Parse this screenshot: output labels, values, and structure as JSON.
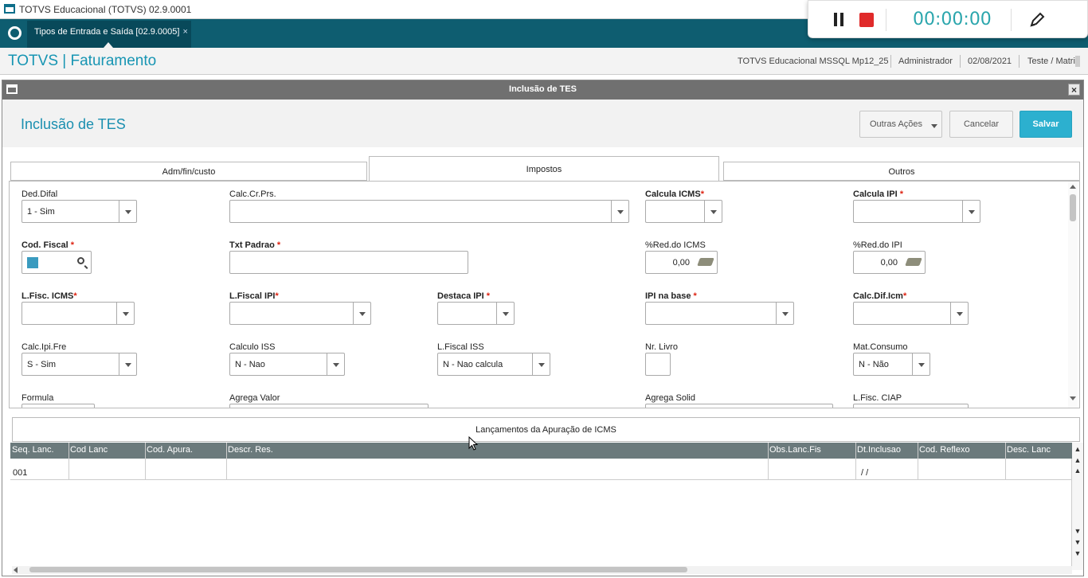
{
  "window": {
    "title": "TOTVS Educacional (TOTVS) 02.9.0001"
  },
  "recorder": {
    "time": "00:00:00"
  },
  "tab": {
    "label": "Tipos de Entrada e Saída [02.9.0005]",
    "close": "×"
  },
  "header": {
    "brand": "TOTVS | Faturamento",
    "company": "TOTVS Educacional MSSQL Mp12_25",
    "user": "Administrador",
    "date": "02/08/2021",
    "branch": "Teste / Matriz"
  },
  "dialog": {
    "bar_title": "Inclusão de TES",
    "close": "×",
    "title": "Inclusão de TES",
    "buttons": {
      "other": "Outras Ações",
      "cancel": "Cancelar",
      "save": "Salvar"
    }
  },
  "tabs": [
    {
      "label": "Adm/fin/custo"
    },
    {
      "label": "Impostos"
    },
    {
      "label": "Outros"
    }
  ],
  "fields": {
    "ded_difal": {
      "label": "Ded.Difal",
      "value": "1 - Sim"
    },
    "calc_cr_prs": {
      "label": "Calc.Cr.Prs.",
      "value": ""
    },
    "calcula_icms": {
      "label": "Calcula ICMS",
      "value": ""
    },
    "calcula_ipi": {
      "label": "Calcula IPI ",
      "value": ""
    },
    "cod_fiscal": {
      "label": "Cod. Fiscal ",
      "value": ""
    },
    "txt_padrao": {
      "label": "Txt Padrao ",
      "value": ""
    },
    "red_icms": {
      "label": "%Red.do ICMS",
      "value": "0,00"
    },
    "red_ipi": {
      "label": "%Red.do IPI",
      "value": "0,00"
    },
    "l_fisc_icms": {
      "label": "L.Fisc. ICMS",
      "value": ""
    },
    "l_fiscal_ipi": {
      "label": "L.Fiscal IPI",
      "value": ""
    },
    "destaca_ipi": {
      "label": "Destaca IPI ",
      "value": ""
    },
    "ipi_na_base": {
      "label": "IPI na base ",
      "value": ""
    },
    "calc_dif_icm": {
      "label": "Calc.Dif.Icm",
      "value": ""
    },
    "calc_ipi_fre": {
      "label": "Calc.Ipi.Fre",
      "value": "S - Sim"
    },
    "calculo_iss": {
      "label": "Calculo ISS",
      "value": "N - Nao"
    },
    "l_fiscal_iss": {
      "label": "L.Fiscal ISS",
      "value": "N - Nao calcula"
    },
    "nr_livro": {
      "label": "Nr. Livro",
      "value": ""
    },
    "mat_consumo": {
      "label": "Mat.Consumo",
      "value": "N - Não"
    },
    "formula": {
      "label": "Formula"
    },
    "agrega_valor": {
      "label": "Agrega Valor"
    },
    "agrega_solid": {
      "label": "Agrega Solid"
    },
    "l_fisc_ciap": {
      "label": "L.Fisc. CIAP"
    }
  },
  "required_mark": "*",
  "apuracao": {
    "title": "Lançamentos da Apuração de ICMS"
  },
  "grid": {
    "columns": [
      "Seq. Lanc.",
      "Cod Lanc",
      "Cod. Apura.",
      "Descr. Res.",
      "Obs.Lanc.Fis",
      "Dt.Inclusao",
      "Cod. Reflexo",
      "Desc. Lanc"
    ],
    "rows": [
      [
        "001",
        "",
        "",
        "",
        "",
        "/ /",
        "",
        ""
      ]
    ]
  }
}
